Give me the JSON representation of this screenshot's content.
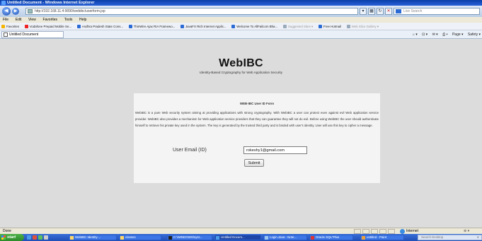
{
  "window": {
    "title": "Untitled Document - Windows Internet Explorer"
  },
  "address": {
    "url": "http://192.168.11.4:9090/webibc/userform.jsp",
    "live_search_placeholder": "Live Search",
    "back_glyph": "◀",
    "forward_glyph": "▶",
    "dropdown_glyph": "▾",
    "refresh_glyph": "↻",
    "stop_glyph": "✕"
  },
  "menu": [
    "File",
    "Edit",
    "View",
    "Favorites",
    "Tools",
    "Help"
  ],
  "favorites": [
    "Favorites",
    "Vodafone Prepaid Mobile Se...",
    "Andhra Pradesh State Cons...",
    "ThinWire Ajax RIA Framewo...",
    "JavaFX Rich Internet Applic...",
    "Welcome To AllFailcom Bha...",
    "Suggested Sites ▾",
    "Free Hotmail",
    "Web Slice Gallery ▾"
  ],
  "tab": {
    "label": "Untitled Document"
  },
  "tab_tools": [
    "⌂ ▾",
    "⊡ ▾",
    "✉ ▾",
    "⎙ ▾",
    "Page ▾",
    "Safety ▾"
  ],
  "page": {
    "logo": "WebIBC",
    "subtitle": "Identity-Based Cryptography for Web Application Security",
    "form_title": "WEB-IBC User ID Form",
    "description": "WebIBC is a pure Web security system aiming at providing applications with strong cryptography. With WebIBC a user can protect even against evil Web application service provider. WebIBC also provides a mechanism for Web application service providers that they can guarantee they will not do evil. Before using WebIBC the user should authenticate himself to retrieve his private key used in the system. The key is generated by the trusted third party and is binded with user's identity. User will use this key to cipher a message.",
    "email_label": "User Email (ID)",
    "email_value": "rokeshy1@gmail.com",
    "submit_label": "Submit"
  },
  "status": {
    "text": "Done",
    "zone": "Internet",
    "zoom": "⊕ ▾"
  },
  "taskbar": {
    "start": "start",
    "tasks": [
      "WebIBC Identity ...",
      "classes",
      "C:\\WINDOWS\\syst...",
      "Untitled Docum...",
      "Login.Java - Note...",
      "Oracle SQL*Plus",
      "untitled - Paint"
    ],
    "search_placeholder": "Search Desktop",
    "search_glyph": "⌕"
  },
  "colors": {
    "page_bg": "#dcdcdc",
    "panel_bg": "#f4f4f4",
    "ie_blue": "#0a3fa8"
  }
}
